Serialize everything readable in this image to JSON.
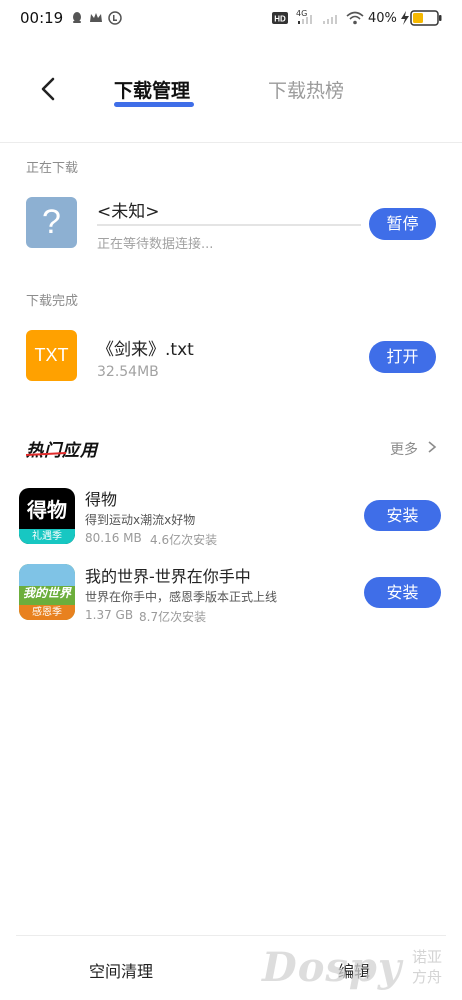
{
  "status_bar": {
    "time": "00:19",
    "battery": "40%",
    "network": "4G"
  },
  "header": {
    "back_icon": "chevron-left-icon",
    "tabs": [
      {
        "label": "下载管理",
        "active": true
      },
      {
        "label": "下载热榜",
        "active": false
      }
    ],
    "accent_color": "#3f6ee8"
  },
  "downloading": {
    "section_label": "正在下载",
    "item": {
      "icon_glyph": "?",
      "name": "<未知>",
      "status": "正在等待数据连接...",
      "progress": 0,
      "action": "暂停"
    }
  },
  "completed": {
    "section_label": "下载完成",
    "item": {
      "icon_text": "TXT",
      "name": "《剑来》.txt",
      "size": "32.54MB",
      "action": "打开"
    }
  },
  "hot_apps": {
    "title": "热门应用",
    "more": "更多",
    "apps": [
      {
        "name": "得物",
        "desc": "得到运动x潮流x好物",
        "size": "80.16 MB",
        "installs": "4.6亿次安装",
        "action": "安装",
        "icon_text": "得物",
        "icon_tag": "礼遇季"
      },
      {
        "name": "我的世界-世界在你手中",
        "desc": "世界在你手中，感恩季版本正式上线",
        "size": "1.37 GB",
        "installs": "8.7亿次安装",
        "action": "安装",
        "icon_text": "我的世界",
        "icon_tag": "感恩季"
      }
    ]
  },
  "bottom_bar": {
    "left": "空间清理",
    "right": "编辑"
  },
  "watermark": {
    "brand": "Dospy",
    "cn_line1": "诺亚",
    "cn_line2": "方舟"
  }
}
